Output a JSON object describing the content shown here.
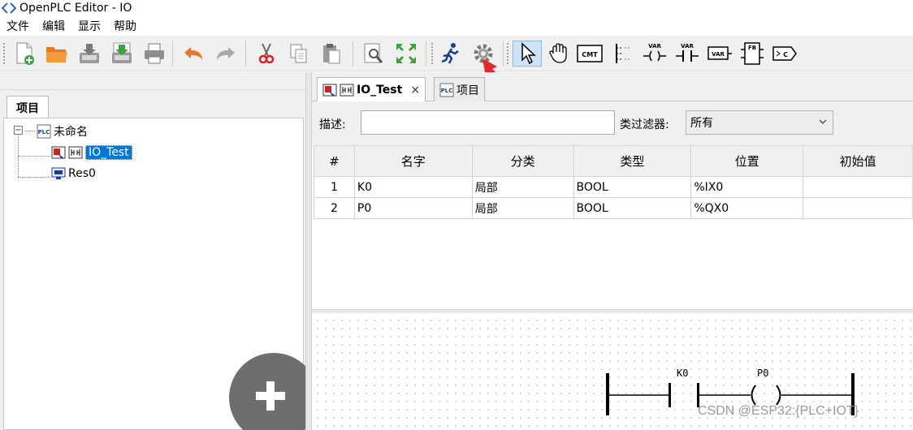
{
  "window": {
    "title": "OpenPLC Editor - IO"
  },
  "menu": {
    "items": [
      "文件",
      "编辑",
      "显示",
      "帮助"
    ]
  },
  "toolbar": {
    "buttons": [
      "new-file",
      "open-folder",
      "save",
      "save-as",
      "print",
      "undo",
      "redo",
      "cut",
      "copy",
      "paste",
      "find",
      "fullscreen",
      "run",
      "build",
      "select-pointer",
      "hand",
      "comment",
      "power-rail",
      "coil",
      "contact",
      "variable",
      "function-block",
      "connection"
    ],
    "labels": {
      "cmt": "CMT",
      "var": "VAR",
      "fb": "FB",
      "conn": "C"
    },
    "active": "select-pointer"
  },
  "project_panel": {
    "tab_label": "项目",
    "tree": {
      "root": "未命名",
      "children": [
        "IO_Test",
        "Res0"
      ],
      "selected": "IO_Test"
    }
  },
  "editor": {
    "tabs": [
      {
        "label": "IO_Test",
        "active": true,
        "close": "×"
      },
      {
        "label": "项目",
        "active": false
      }
    ],
    "filter": {
      "desc_label": "描述:",
      "desc_value": "",
      "class_filter_label": "类过滤器:",
      "class_filter_value": "所有"
    },
    "variables": {
      "columns": [
        "#",
        "名字",
        "分类",
        "类型",
        "位置",
        "初始值"
      ],
      "rows": [
        [
          "1",
          "K0",
          "局部",
          "BOOL",
          "%IX0",
          ""
        ],
        [
          "2",
          "P0",
          "局部",
          "BOOL",
          "%QX0",
          ""
        ]
      ]
    },
    "ladder": {
      "contact_label": "K0",
      "coil_label": "P0"
    }
  },
  "watermark": "CSDN @ESP32:{PLC+IOT}",
  "colors": {
    "selection": "#0078d7",
    "arrow": "#e8262c",
    "toolbar_bg": "#f0f0f0"
  }
}
